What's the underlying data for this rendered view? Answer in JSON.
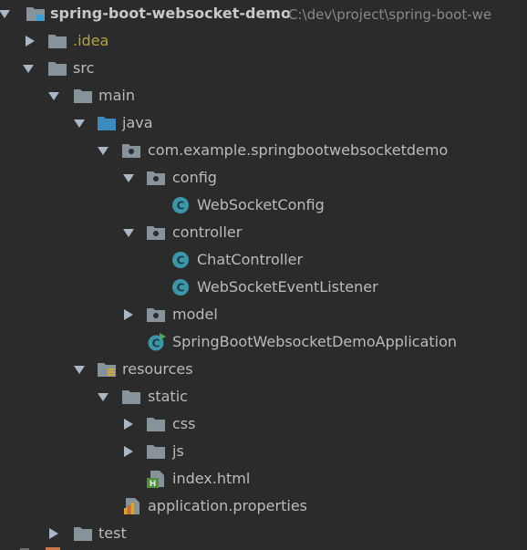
{
  "window": "project-tool-window",
  "root": {
    "name": "spring-boot-websocket-demo",
    "path": "C:\\dev\\project\\spring-boot-we"
  },
  "tree": {
    "idea": ".idea",
    "src": "src",
    "main": "main",
    "java": "java",
    "package": "com.example.springbootwebsocketdemo",
    "config": "config",
    "websocket_config": "WebSocketConfig",
    "controller": "controller",
    "chat_controller": "ChatController",
    "websocket_event_listener": "WebSocketEventListener",
    "model": "model",
    "application_class": "SpringBootWebsocketDemoApplication",
    "resources": "resources",
    "static": "static",
    "css": "css",
    "js": "js",
    "index_html": "index.html",
    "application_properties": "application.properties",
    "test": "test"
  },
  "colors": {
    "background": "#2b2b2b",
    "text": "#bbbbbb",
    "folder": "#87939a",
    "source_folder": "#3b8bc0",
    "class_icon": "#3a96a8",
    "ignored_text": "#b4a53a"
  },
  "icons": {
    "expanded": "triangle-down-icon",
    "collapsed": "triangle-right-icon",
    "folder": "folder-icon",
    "source_root": "source-folder-icon",
    "package": "package-icon",
    "class": "class-icon",
    "resources": "resources-folder-icon",
    "html": "html-file-icon",
    "properties": "properties-file-icon"
  }
}
